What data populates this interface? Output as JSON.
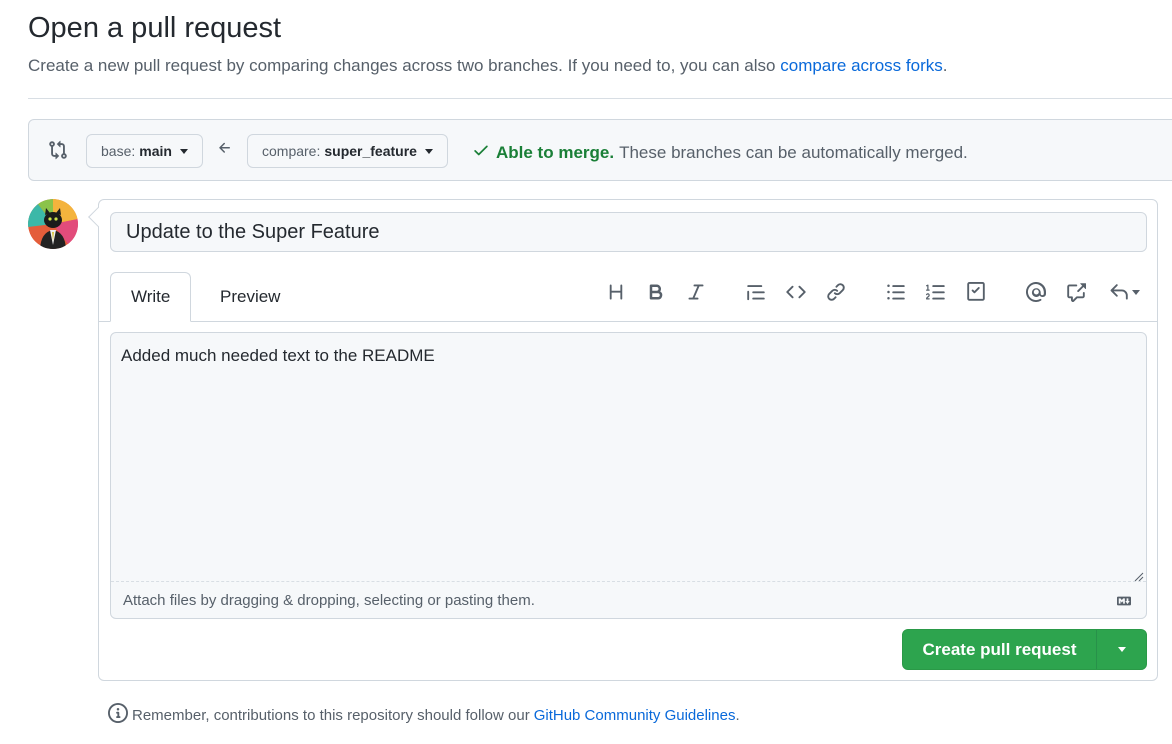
{
  "header": {
    "title": "Open a pull request",
    "subtitle": "Create a new pull request by comparing changes across two branches. If you need to, you can also",
    "subtitle_link": "compare across forks",
    "subtitle_end": "."
  },
  "compare": {
    "base_label": "base:",
    "base_value": "main",
    "compare_label": "compare:",
    "compare_value": "super_feature",
    "merge_status": "Able to merge.",
    "merge_detail": "These branches can be automatically merged."
  },
  "composer": {
    "title_value": "Update to the Super Feature",
    "tabs": [
      {
        "label": "Write",
        "active": true
      },
      {
        "label": "Preview",
        "active": false
      }
    ],
    "toolbar_icons": [
      "heading-icon",
      "bold-icon",
      "italic-icon",
      "quote-icon",
      "code-icon",
      "link-icon",
      "unordered-list-icon",
      "ordered-list-icon",
      "task-list-icon",
      "mention-icon",
      "cross-reference-icon",
      "saved-replies-icon"
    ],
    "body_text": "Added much needed text to the README",
    "attach_hint": "Attach files by dragging & dropping, selecting or pasting them.",
    "submit_label": "Create pull request"
  },
  "footer": {
    "note": "Remember, contributions to this repository should follow our",
    "link": "GitHub Community Guidelines",
    "end": "."
  },
  "colors": {
    "accent": "#0969da",
    "success": "#1a7f37",
    "button_green": "#2da44e"
  }
}
